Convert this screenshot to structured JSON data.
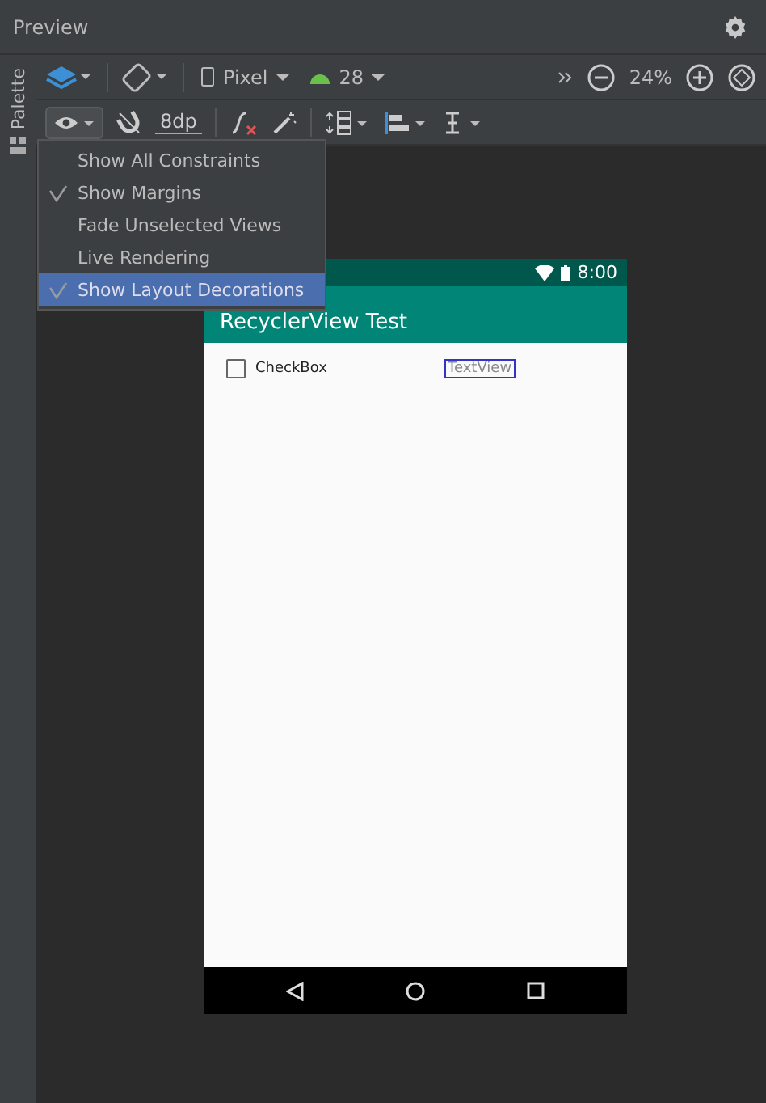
{
  "header": {
    "title": "Preview"
  },
  "side_tab": {
    "label": "Palette"
  },
  "toolbar": {
    "device": "Pixel",
    "api": "28",
    "zoom": "24%",
    "margin": "8dp"
  },
  "view_menu": {
    "items": [
      {
        "label": "Show All Constraints",
        "checked": false,
        "selected": false
      },
      {
        "label": "Show Margins",
        "checked": true,
        "selected": false
      },
      {
        "label": "Fade Unselected Views",
        "checked": false,
        "selected": false
      },
      {
        "label": "Live Rendering",
        "checked": false,
        "selected": false
      },
      {
        "label": "Show Layout Decorations",
        "checked": true,
        "selected": true
      }
    ]
  },
  "phone": {
    "time": "8:00",
    "app_title": "RecyclerView Test",
    "checkbox": {
      "label": "CheckBox",
      "checked": false
    },
    "textview": "TextView"
  }
}
